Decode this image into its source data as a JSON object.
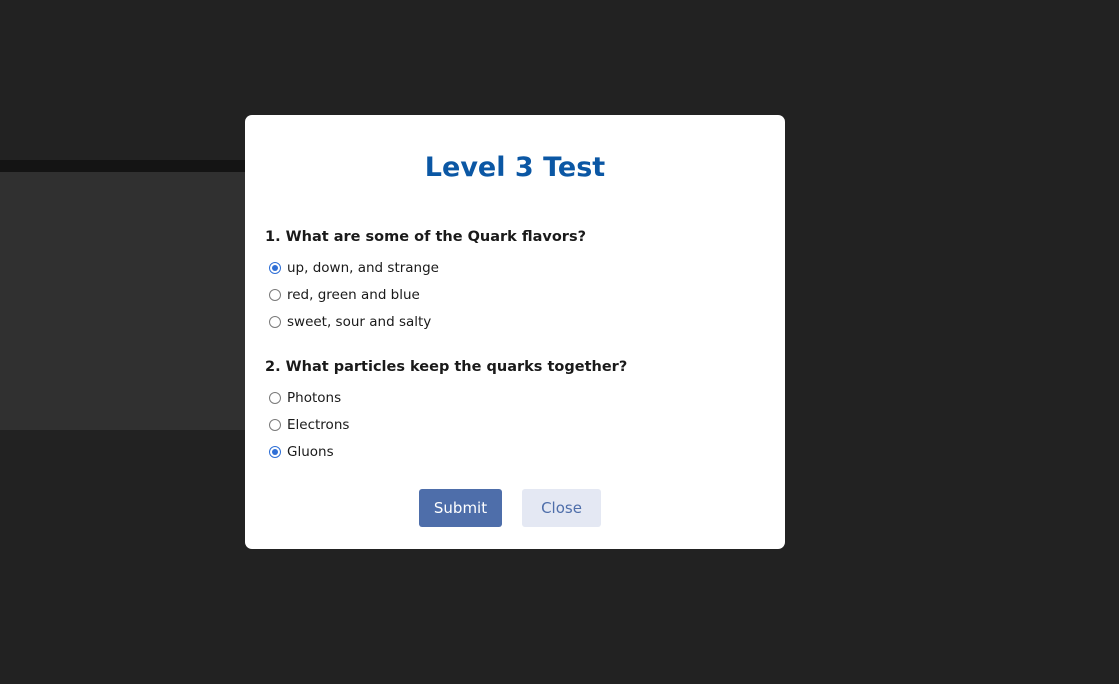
{
  "modal": {
    "title": "Level 3 Test",
    "questions": [
      {
        "text": "1. What are some of the Quark flavors?",
        "options": [
          {
            "label": "up, down, and strange",
            "selected": true
          },
          {
            "label": "red, green and blue",
            "selected": false
          },
          {
            "label": "sweet, sour and salty",
            "selected": false
          }
        ]
      },
      {
        "text": "2. What particles keep the quarks together?",
        "options": [
          {
            "label": "Photons",
            "selected": false
          },
          {
            "label": "Electrons",
            "selected": false
          },
          {
            "label": "Gluons",
            "selected": true
          }
        ]
      }
    ],
    "buttons": {
      "submit_label": "Submit",
      "close_label": "Close"
    }
  },
  "colors": {
    "background": "#222222",
    "title": "#0b57a4",
    "accent": "#2f6fd6",
    "submit_bg": "#4e6eaa",
    "close_bg": "#e4e8f3"
  }
}
